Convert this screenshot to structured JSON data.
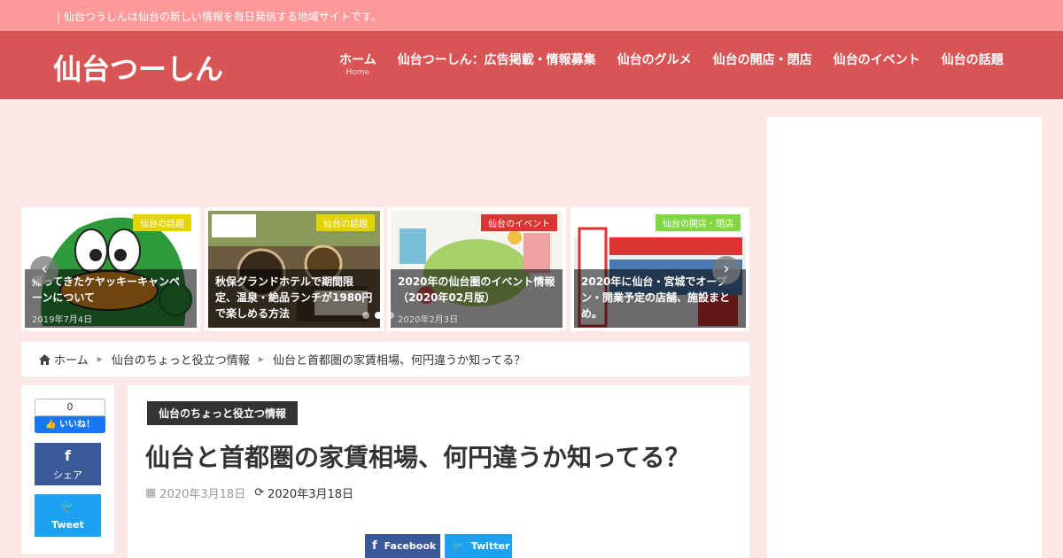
{
  "topbar": {
    "tagline": "| 仙台つうしんは仙台の新しい情報を毎日発信する地域サイトです。"
  },
  "header": {
    "site_title": "仙台つーしん",
    "nav": [
      {
        "label": "ホーム",
        "sub": "Home"
      },
      {
        "label": "仙台つーしん：広告掲載・情報募集",
        "sub": ""
      },
      {
        "label": "仙台のグルメ",
        "sub": ""
      },
      {
        "label": "仙台の開店・閉店",
        "sub": ""
      },
      {
        "label": "仙台のイベント",
        "sub": ""
      },
      {
        "label": "仙台の話題",
        "sub": ""
      }
    ]
  },
  "carousel": {
    "prev_icon": "chevron-left-icon",
    "next_icon": "chevron-right-icon",
    "prev_glyph": "‹",
    "next_glyph": "›",
    "cards": [
      {
        "category": "仙台の話題",
        "category_color": "#e3d300",
        "title": "帰ってきたケヤッキーキャンペーンについて",
        "date": "2019年7月4日"
      },
      {
        "category": "仙台の話題",
        "category_color": "#e3d300",
        "title": "秋保グランドホテルで期間限定、温泉・絶品ランチが1980円で楽しめる方法",
        "date": ""
      },
      {
        "category": "仙台のイベント",
        "category_color": "#dd3333",
        "title": "2020年の仙台圏のイベント情報（2020年02月版）",
        "date": "2020年2月3日"
      },
      {
        "category": "仙台の開店・閉店",
        "category_color": "#81d742",
        "title": "2020年に仙台・宮城でオープン・開業予定の店舗、施設まとめ。",
        "date": ""
      }
    ]
  },
  "breadcrumb": {
    "home_icon": "home-icon",
    "items": [
      "ホーム",
      "仙台のちょっと役立つ情報",
      "仙台と首都圏の家賃相場、何円違うか知ってる？"
    ]
  },
  "share_column": {
    "like_count": "0",
    "like_label": "いいね！",
    "facebook_label": "シェア",
    "facebook_glyph": "f",
    "twitter_label": "Tweet",
    "twitter_glyph": "🐦"
  },
  "article": {
    "category": "仙台のちょっと役立つ情報",
    "title": "仙台と首都圏の家賃相場、何円違うか知ってる？",
    "published": "2020年3月18日",
    "updated": "2020年3月18日",
    "share_facebook": "Facebook",
    "share_twitter": "Twitter"
  },
  "colors": {
    "topbar": "#ff9999",
    "header": "#d95555",
    "background": "#fde8e8",
    "facebook": "#3b5998",
    "twitter": "#1da1f2"
  }
}
